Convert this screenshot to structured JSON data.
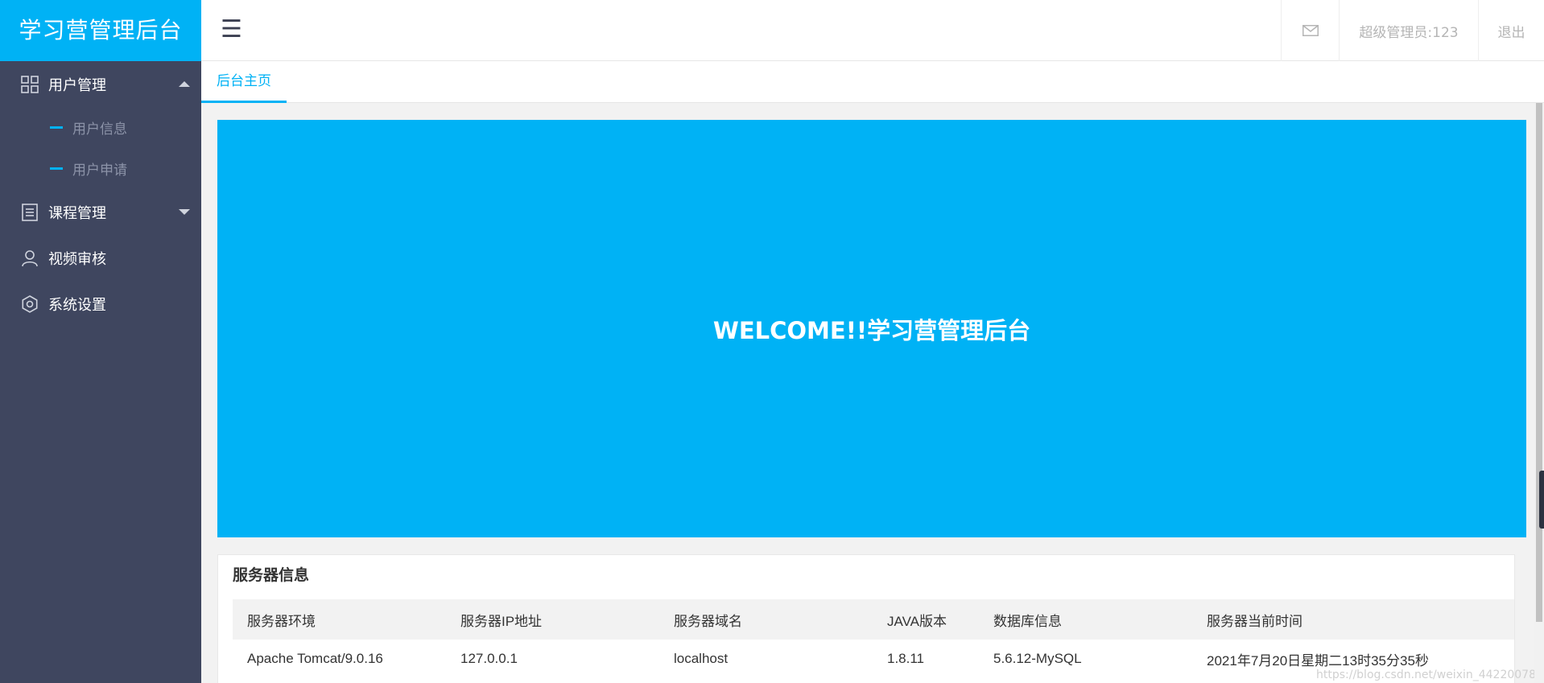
{
  "app": {
    "title": "学习营管理后台"
  },
  "header": {
    "menu_toggle_glyph": "☰",
    "user_label": "超级管理员:123",
    "logout_label": "退出"
  },
  "sidebar": {
    "items": [
      {
        "label": "用户管理",
        "icon": "grid-icon",
        "expanded": true,
        "children": [
          {
            "label": "用户信息"
          },
          {
            "label": "用户申请"
          }
        ]
      },
      {
        "label": "课程管理",
        "icon": "list-icon",
        "expanded": false
      },
      {
        "label": "视频审核",
        "icon": "user-icon"
      },
      {
        "label": "系统设置",
        "icon": "gear-icon"
      }
    ]
  },
  "tabs": [
    {
      "label": "后台主页",
      "active": true
    }
  ],
  "welcome": {
    "text": "WELCOME!!学习营管理后台"
  },
  "server_panel": {
    "title": "服务器信息",
    "columns": [
      "服务器环境",
      "服务器IP地址",
      "服务器域名",
      "JAVA版本",
      "数据库信息",
      "服务器当前时间"
    ],
    "row": [
      "Apache Tomcat/9.0.16",
      "127.0.0.1",
      "localhost",
      "1.8.11",
      "5.6.12-MySQL",
      "2021年7月20日星期二13时35分35秒"
    ]
  },
  "watermark": "https://blog.csdn.net/weixin_44220078",
  "colors": {
    "accent": "#00b2f5",
    "sidebar_bg": "#3f465f",
    "content_bg": "#f2f2f2"
  }
}
